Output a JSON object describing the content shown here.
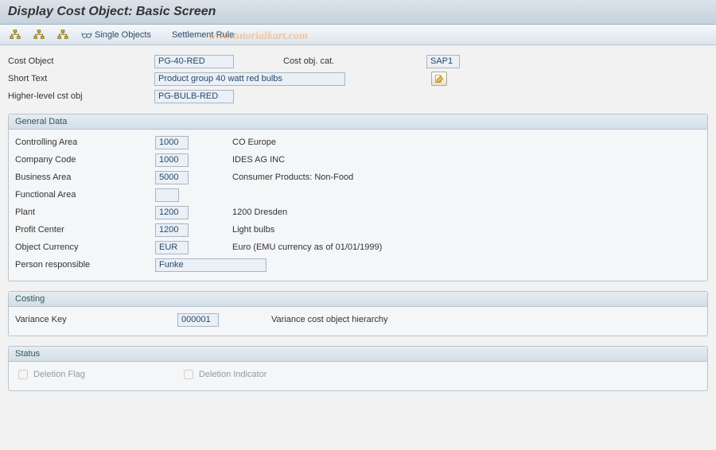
{
  "title": "Display Cost Object: Basic Screen",
  "watermark": "www.tutorialkart.com",
  "toolbar": {
    "single_objects": "Single Objects",
    "settlement_rule": "Settlement Rule"
  },
  "header": {
    "cost_object_lbl": "Cost Object",
    "cost_object": "PG-40-RED",
    "cost_obj_cat_lbl": "Cost obj. cat.",
    "cost_obj_cat": "SAP1",
    "short_text_lbl": "Short Text",
    "short_text": "Product group 40 watt red bulbs",
    "higher_lbl": "Higher-level cst obj",
    "higher": "PG-BULB-RED"
  },
  "general": {
    "title": "General Data",
    "controlling_area_lbl": "Controlling Area",
    "controlling_area": "1000",
    "controlling_area_txt": "CO Europe",
    "company_code_lbl": "Company Code",
    "company_code": "1000",
    "company_code_txt": "IDES AG INC",
    "business_area_lbl": "Business Area",
    "business_area": "5000",
    "business_area_txt": "Consumer Products: Non-Food",
    "functional_area_lbl": "Functional Area",
    "functional_area": "",
    "plant_lbl": "Plant",
    "plant": "1200",
    "plant_txt": "1200 Dresden",
    "profit_center_lbl": "Profit Center",
    "profit_center": "1200",
    "profit_center_txt": "Light bulbs",
    "object_currency_lbl": "Object Currency",
    "object_currency": "EUR",
    "object_currency_txt": "Euro (EMU currency as of 01/01/1999)",
    "person_resp_lbl": "Person responsible",
    "person_resp": "Funke"
  },
  "costing": {
    "title": "Costing",
    "variance_key_lbl": "Variance Key",
    "variance_key": "000001",
    "variance_key_txt": "Variance cost object hierarchy"
  },
  "status": {
    "title": "Status",
    "deletion_flag_lbl": "Deletion Flag",
    "deletion_ind_lbl": "Deletion Indicator"
  }
}
